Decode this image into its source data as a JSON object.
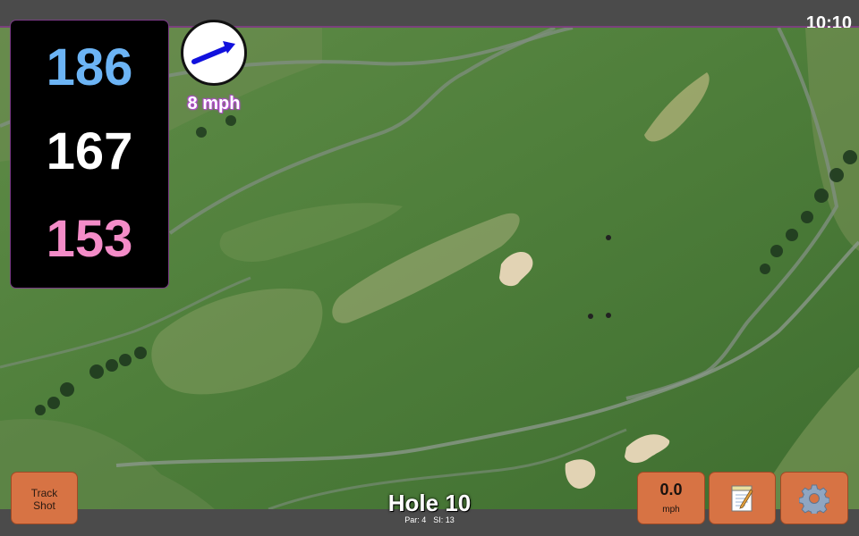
{
  "status": {
    "time": "10:10"
  },
  "distances": {
    "back": "186",
    "middle": "167",
    "front": "153"
  },
  "wind": {
    "speed_text": "8 mph",
    "direction": "east-north-east"
  },
  "hole": {
    "title": "Hole 10",
    "par": "Par: 4",
    "si": "SI: 13"
  },
  "buttons": {
    "track_shot": "Track\nShot",
    "wind_value": "0.0",
    "wind_unit": "mph",
    "notes_icon": "notepad-icon",
    "settings_icon": "gear-icon"
  },
  "colors": {
    "back": "#6cb4f5",
    "middle": "#ffffff",
    "front": "#f48cc8",
    "button": "#d77344",
    "wind_arrow": "#1111dd",
    "wind_text_glow": "#b34bd1"
  }
}
